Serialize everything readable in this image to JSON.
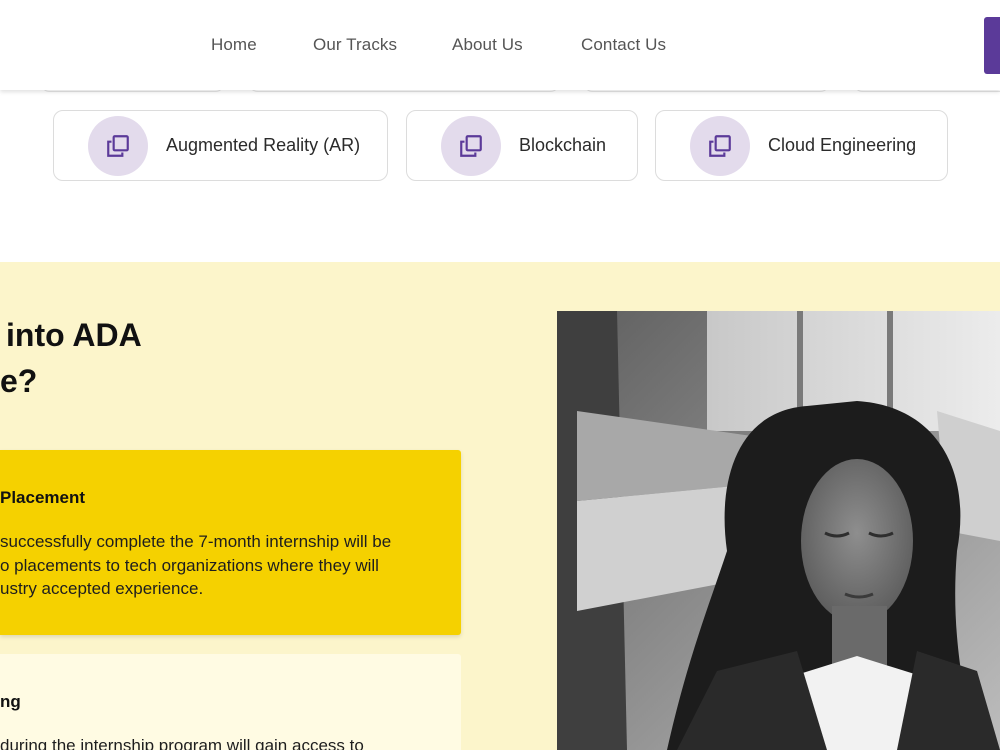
{
  "nav": {
    "items": [
      {
        "label": "Home"
      },
      {
        "label": "Our Tracks"
      },
      {
        "label": "About Us"
      },
      {
        "label": "Contact Us"
      }
    ]
  },
  "tracks": [
    {
      "label": "Augmented Reality (AR)",
      "icon": "copy-icon"
    },
    {
      "label": "Blockchain",
      "icon": "copy-icon"
    },
    {
      "label": "Cloud Engineering",
      "icon": "copy-icon"
    }
  ],
  "why": {
    "title_line1": "into ADA",
    "title_line2": "e?",
    "benefits": [
      {
        "title": "Placement",
        "lines": [
          "successfully complete the 7-month internship will be",
          "o placements to tech organizations where they will",
          "ustry accepted experience."
        ]
      },
      {
        "title": "ng",
        "lines": [
          " during the internship program will gain access to"
        ]
      }
    ]
  },
  "colors": {
    "accent_purple": "#5b3a99",
    "icon_bg": "#e3dbec",
    "section_bg": "#fcf5cb",
    "active_card": "#f5d100",
    "inactive_card": "#fffbe3"
  }
}
